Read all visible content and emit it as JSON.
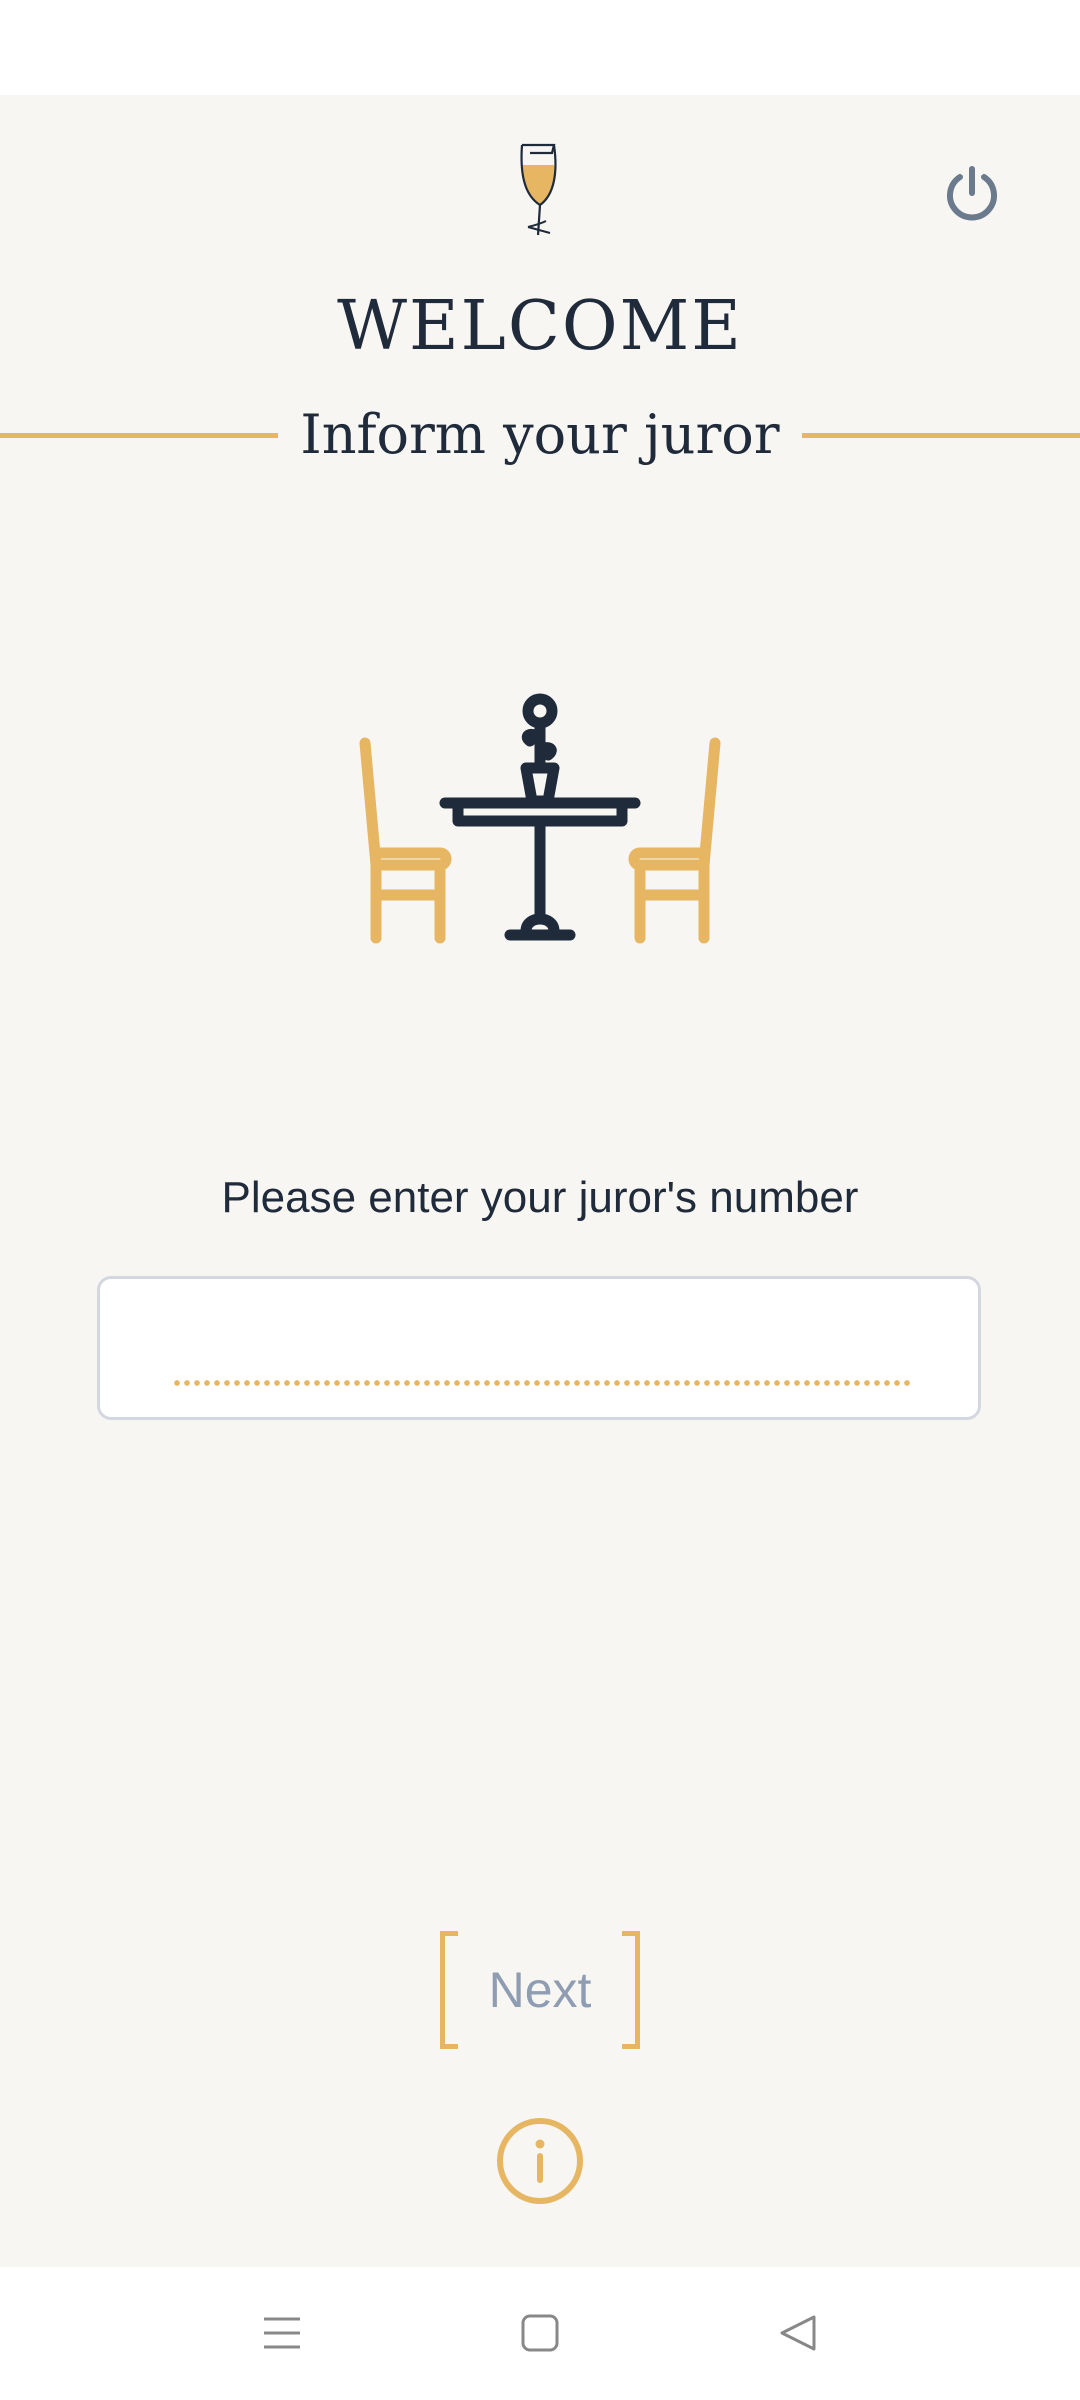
{
  "header": {
    "logo_icon": "wine-glass-icon",
    "power_icon": "power-icon"
  },
  "welcome": {
    "title": "WELCOME",
    "subtitle": "Inform your juror"
  },
  "illustration": {
    "icon": "restaurant-table-icon"
  },
  "form": {
    "prompt": "Please enter your juror's number",
    "juror_number_value": ""
  },
  "actions": {
    "next_label": "Next",
    "info_icon": "info-icon"
  },
  "system_nav": {
    "recents_icon": "menu-icon",
    "home_icon": "home-square-icon",
    "back_icon": "back-triangle-icon"
  },
  "colors": {
    "background": "#f7f6f3",
    "accent_gold": "#e6b663",
    "text_dark": "#1f2a3a",
    "disabled_text": "#8f9db3",
    "power_icon": "#6b7a8c"
  }
}
